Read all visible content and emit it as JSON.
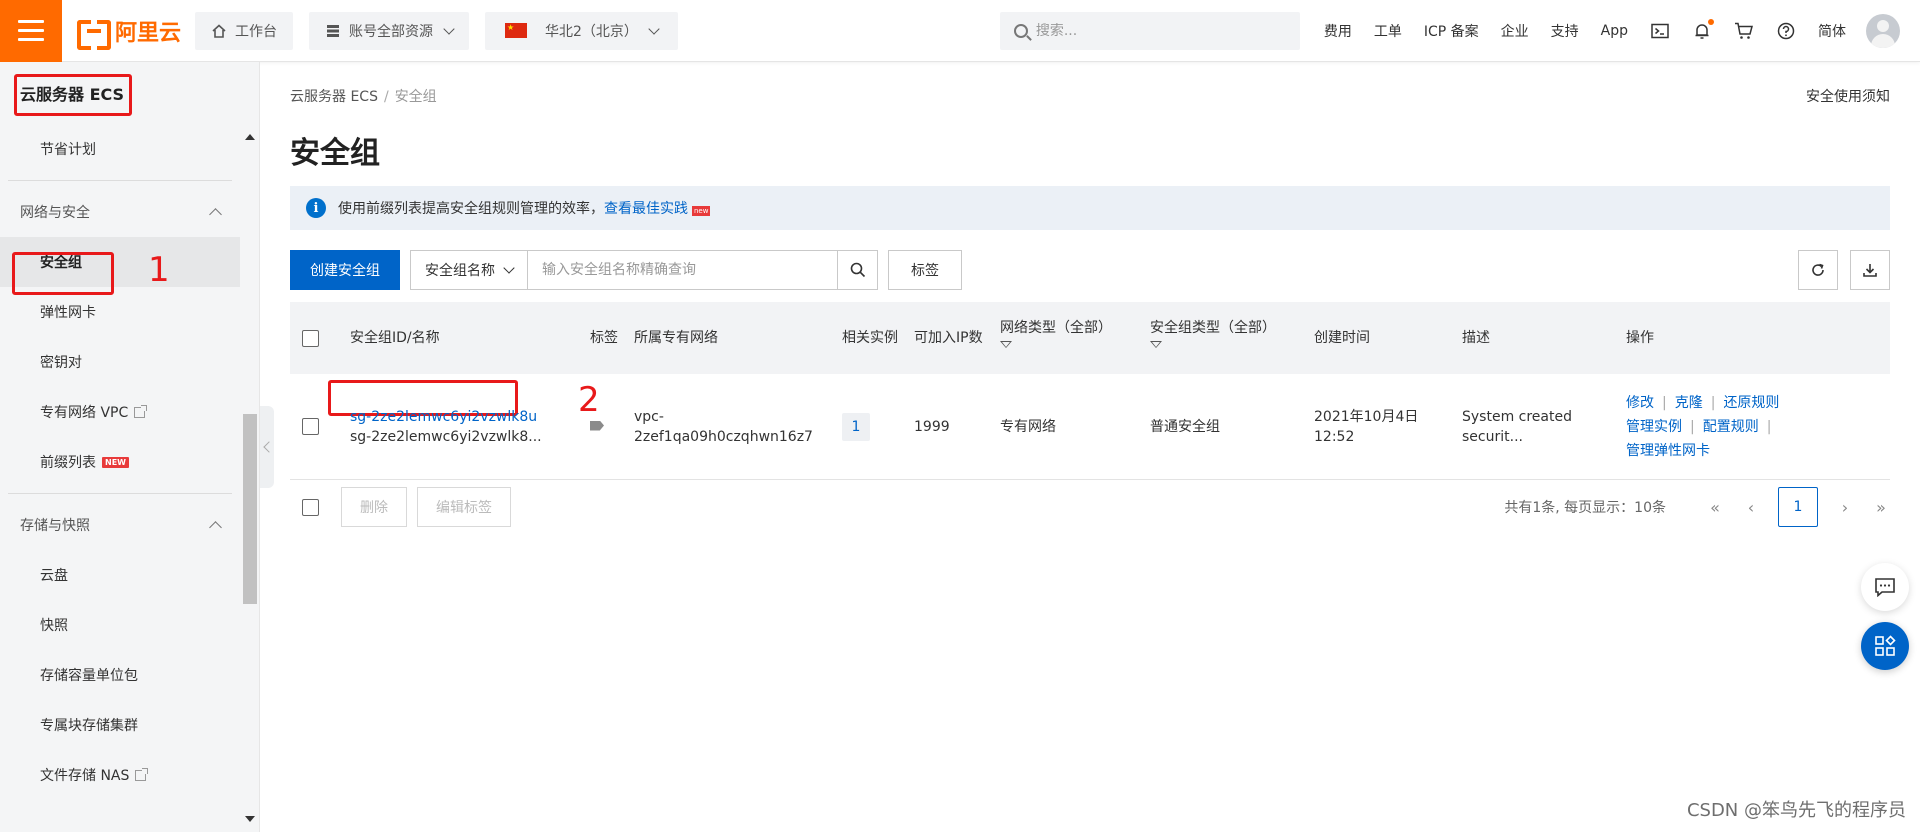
{
  "topbar": {
    "logo_text": "阿里云",
    "workbench": "工作台",
    "resources": "账号全部资源",
    "region": "华北2（北京）",
    "search_placeholder": "搜索...",
    "links": [
      "费用",
      "工单",
      "ICP 备案",
      "企业",
      "支持",
      "App"
    ],
    "language": "简体"
  },
  "sidebar": {
    "title": "云服务器 ECS",
    "items_top": [
      "节省计划"
    ],
    "group_network": "网络与安全",
    "network_items": [
      "安全组",
      "弹性网卡",
      "密钥对",
      "专有网络 VPC",
      "前缀列表"
    ],
    "new_badge": "NEW",
    "group_storage": "存储与快照",
    "storage_items": [
      "云盘",
      "快照",
      "存储容量单位包",
      "专属块存储集群",
      "文件存储 NAS"
    ]
  },
  "annotations": {
    "num1": "1",
    "num2": "2"
  },
  "main": {
    "breadcrumb_root": "云服务器 ECS",
    "breadcrumb_sep": "/",
    "breadcrumb_current": "安全组",
    "notice_link": "安全使用须知",
    "title": "安全组",
    "info_text": "使用前缀列表提高安全组规则管理的效率，",
    "info_link": "查看最佳实践",
    "info_new": "new",
    "create_button": "创建安全组",
    "filter_select": "安全组名称",
    "search_placeholder": "输入安全组名称精确查询",
    "tag_button": "标签"
  },
  "table": {
    "headers": {
      "id_name": "安全组ID/名称",
      "tag": "标签",
      "vpc": "所属专有网络",
      "instances": "相关实例",
      "ips": "可加入IP数",
      "net_type": "网络类型（全部）",
      "sg_type": "安全组类型（全部）",
      "created": "创建时间",
      "desc": "描述",
      "ops": "操作"
    },
    "rows": [
      {
        "id": "sg-2ze2lemwc6yi2vzwlk8u",
        "name": "sg-2ze2lemwc6yi2vzwlk8...",
        "vpc_line1": "vpc-",
        "vpc_line2": "2zef1qa09h0czqhwn16z7",
        "instances": "1",
        "ips": "1999",
        "net_type": "专有网络",
        "sg_type": "普通安全组",
        "created_line1": "2021年10月4日",
        "created_line2": "12:52",
        "desc_line1": "System created",
        "desc_line2": "securit...",
        "op_modify": "修改",
        "op_clone": "克隆",
        "op_restore": "还原规则",
        "op_manage_instances": "管理实例",
        "op_config_rules": "配置规则",
        "op_manage_eni": "管理弹性网卡"
      }
    ]
  },
  "footer": {
    "delete": "删除",
    "edit_tags": "编辑标签",
    "summary": "共有1条, 每页显示：10条",
    "first": "«",
    "prev": "‹",
    "current_page": "1",
    "next": "›",
    "last": "»"
  },
  "watermark": "CSDN @笨鸟先飞的程序员",
  "colors": {
    "brand": "#ff6a00",
    "primary": "#0064c8",
    "annotation": "#e8191a"
  }
}
